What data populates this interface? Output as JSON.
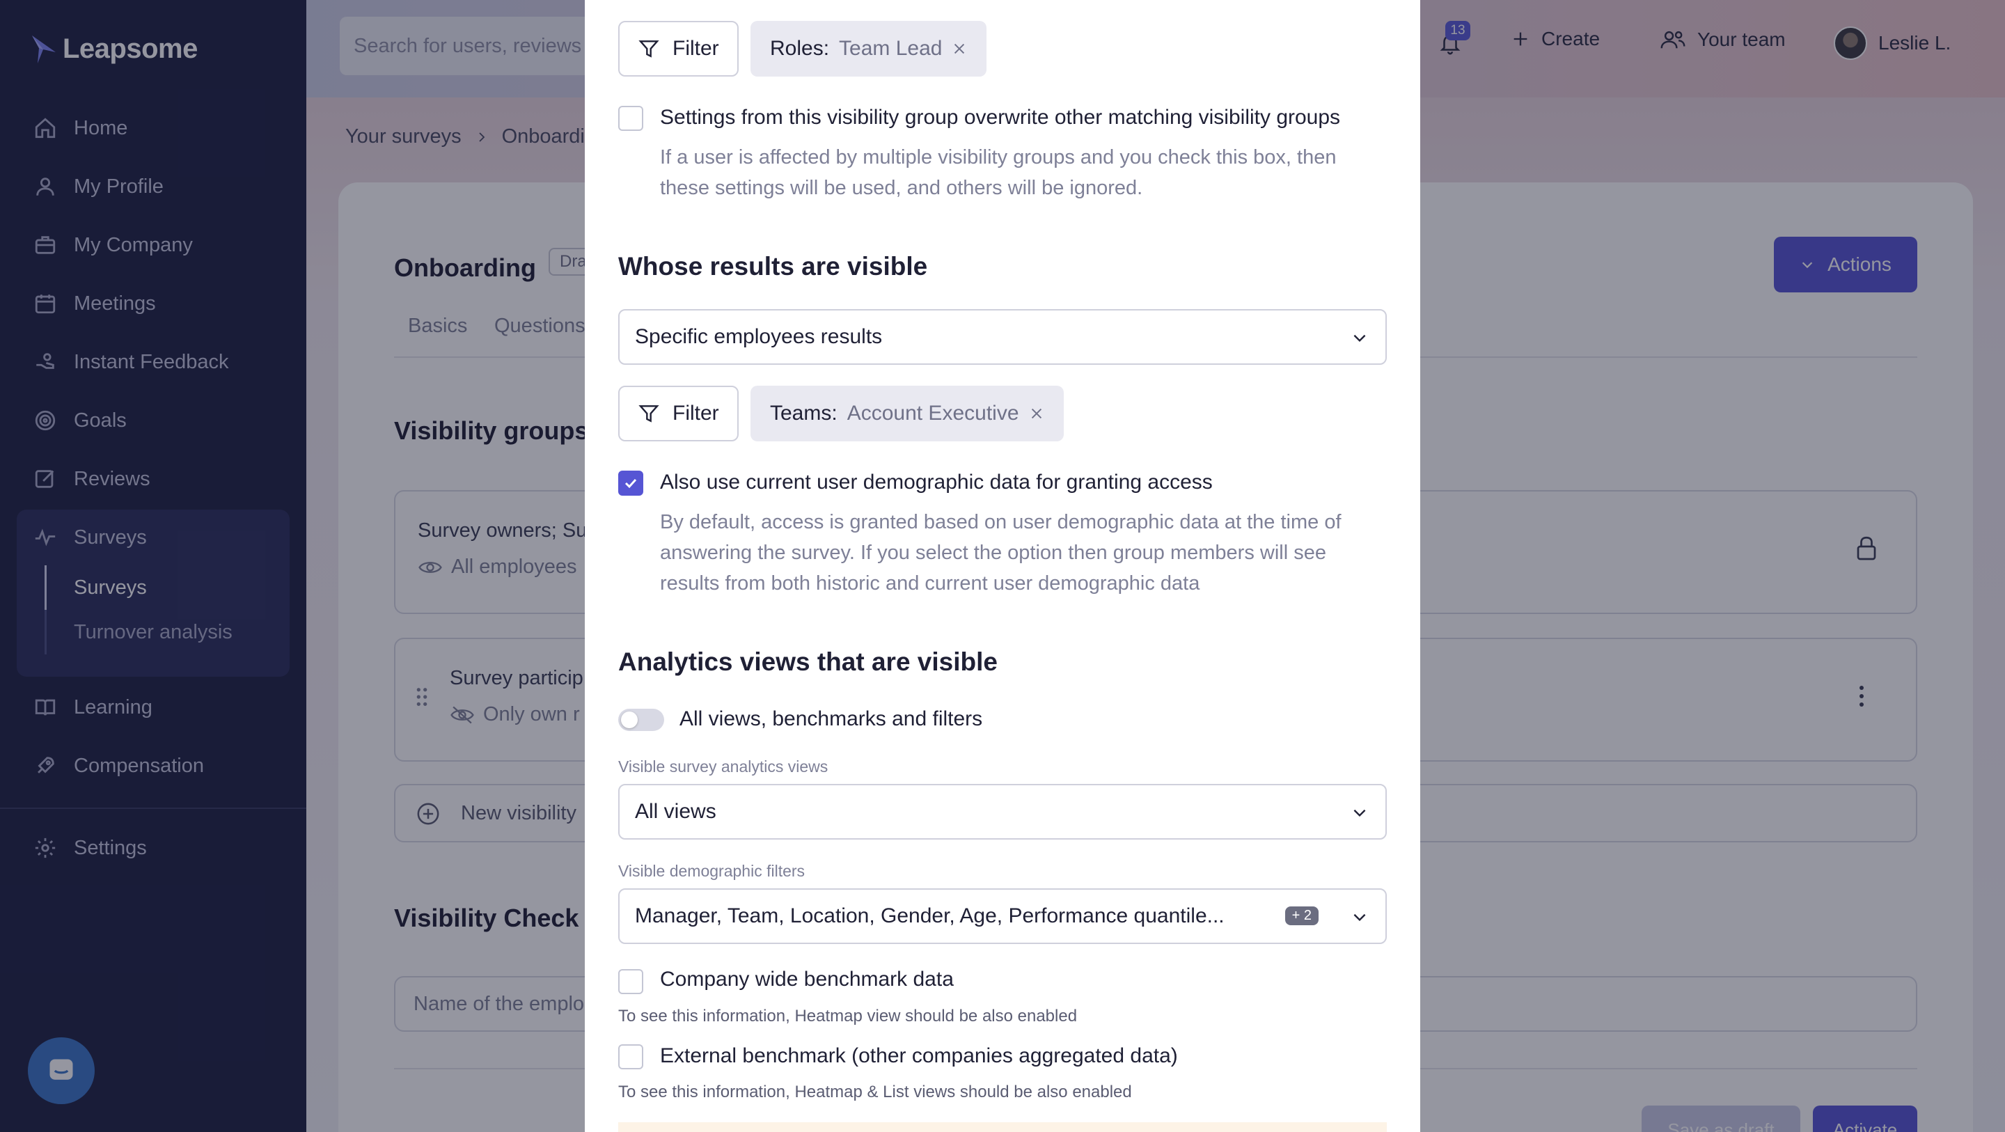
{
  "app": {
    "logo_text": "Leapsome"
  },
  "sidebar": {
    "items": [
      {
        "label": "Home",
        "icon": "home-icon"
      },
      {
        "label": "My Profile",
        "icon": "user-icon"
      },
      {
        "label": "My Company",
        "icon": "briefcase-icon"
      },
      {
        "label": "Meetings",
        "icon": "calendar-icon"
      },
      {
        "label": "Instant Feedback",
        "icon": "feedback-hand-icon"
      },
      {
        "label": "Goals",
        "icon": "target-icon"
      },
      {
        "label": "Reviews",
        "icon": "edit-icon"
      },
      {
        "label": "Surveys",
        "icon": "pulse-icon"
      },
      {
        "label": "Learning",
        "icon": "book-icon"
      },
      {
        "label": "Compensation",
        "icon": "rocket-icon"
      },
      {
        "label": "Settings",
        "icon": "gear-icon"
      }
    ],
    "surveys_sub": [
      {
        "label": "Surveys",
        "active": true
      },
      {
        "label": "Turnover analysis",
        "active": false
      }
    ]
  },
  "topbar": {
    "search_placeholder": "Search for users, reviews",
    "notification_count": "13",
    "create_label": "Create",
    "team_label": "Your team",
    "user_name": "Leslie L."
  },
  "background": {
    "breadcrumb": [
      "Your surveys",
      "Onboardi"
    ],
    "title": "Onboarding",
    "draft_badge": "Dra",
    "actions_label": "Actions",
    "tabs": [
      "Basics",
      "Questions"
    ],
    "visibility_groups_heading": "Visibility groups",
    "group1_title": "Survey owners; Su",
    "group1_sub": "All employees",
    "group2_title": "Survey particip",
    "group2_sub": "Only own r",
    "new_group": "New visibility",
    "visibility_check_heading": "Visibility Check",
    "name_placeholder": "Name of the emplo",
    "save_draft": "Save as draft",
    "activate": "Activate"
  },
  "modal": {
    "filter_label": "Filter",
    "roles_chip": {
      "key": "Roles:",
      "value": "Team Lead"
    },
    "overwrite_label": "Settings from this visibility group overwrite other matching visibility groups",
    "overwrite_desc_1": "If a user is affected by multiple visibility groups and you check this box, then",
    "overwrite_desc_2": "these settings will be used, and others will be ignored.",
    "whose_heading": "Whose results are visible",
    "whose_select": "Specific employees results",
    "teams_chip": {
      "key": "Teams:",
      "value": "Account Executive"
    },
    "demographic_label": "Also use current user demographic data for granting access",
    "demographic_desc_1": "By default, access is granted based on user demographic data at the time of",
    "demographic_desc_2": "answering the survey. If you select the option then group members will see",
    "demographic_desc_3": "results from both historic and current user demographic data",
    "analytics_heading": "Analytics views that are visible",
    "all_views_toggle": "All views, benchmarks and filters",
    "views_label": "Visible survey analytics views",
    "views_select": "All views",
    "filters_label": "Visible demographic filters",
    "filters_select": "Manager, Team, Location, Gender, Age, Performance quantile...",
    "filters_extra": "+ 2",
    "company_benchmark": "Company wide benchmark data",
    "company_hint": "To see this information, Heatmap view should be also enabled",
    "external_benchmark": "External benchmark (other companies aggregated data)",
    "external_hint": "To see this information, Heatmap & List views should be also enabled"
  },
  "colors": {
    "accent": "#5655d4",
    "sidebar_bg": "#1e2142",
    "sidebar_active": "#2b2f5c"
  }
}
